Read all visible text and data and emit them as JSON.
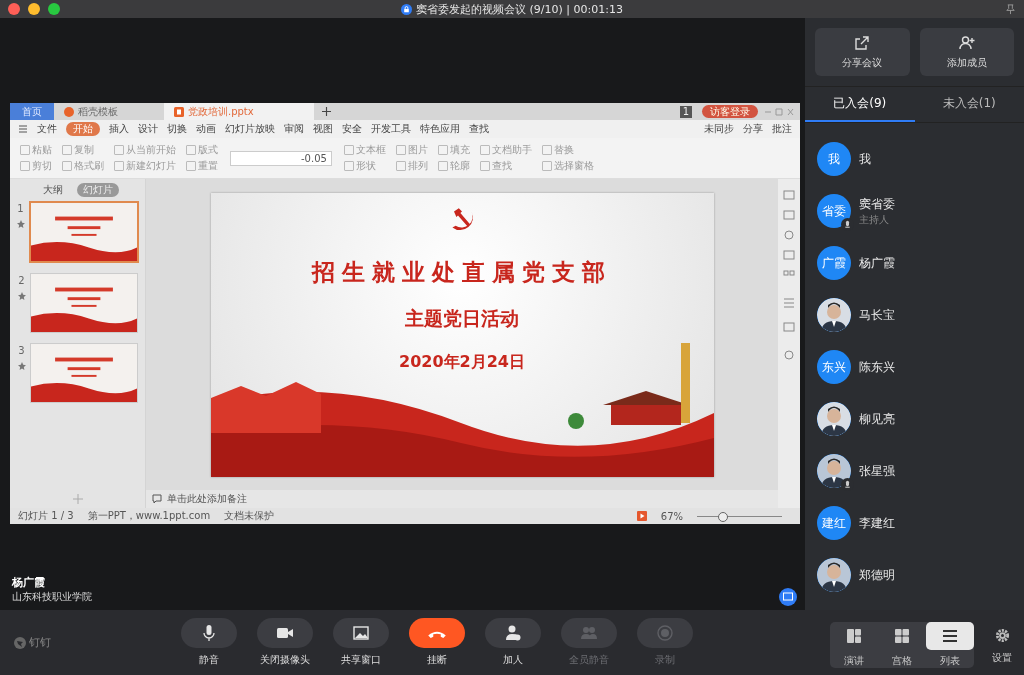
{
  "window": {
    "title": "窦省委发起的视频会议 (9/10) | 00:01:13"
  },
  "shared_screen": {
    "tabs": [
      {
        "label": "首页",
        "kind": "home",
        "selected": false
      },
      {
        "label": "稻壳模板",
        "kind": "template",
        "selected": false
      },
      {
        "label": "党政培训.pptx",
        "kind": "document",
        "selected": true
      }
    ],
    "page_count": "1",
    "login_button": "访客登录",
    "menu": [
      {
        "label": "文件",
        "selected": false
      },
      {
        "label": "开始",
        "selected": true
      },
      {
        "label": "插入",
        "selected": false
      },
      {
        "label": "设计",
        "selected": false
      },
      {
        "label": "切换",
        "selected": false
      },
      {
        "label": "动画",
        "selected": false
      },
      {
        "label": "幻灯片放映",
        "selected": false
      },
      {
        "label": "审阅",
        "selected": false
      },
      {
        "label": "视图",
        "selected": false
      },
      {
        "label": "安全",
        "selected": false
      },
      {
        "label": "开发工具",
        "selected": false
      },
      {
        "label": "特色应用",
        "selected": false
      },
      {
        "label": "查找",
        "selected": false
      }
    ],
    "menu_right": [
      "未同步",
      "分享",
      "批注"
    ],
    "ribbon_left": [
      "粘贴",
      "剪切",
      "复制",
      "格式刷",
      "从当前开始",
      "新建幻灯片",
      "版式",
      "重置"
    ],
    "font_size": "-0.05",
    "ribbon_right": [
      "文本框",
      "形状",
      "图片",
      "排列",
      "填充",
      "轮廓",
      "文档助手",
      "查找",
      "替换",
      "选择窗格"
    ],
    "panel_tabs": [
      {
        "label": "大纲",
        "selected": false
      },
      {
        "label": "幻灯片",
        "selected": true
      }
    ],
    "thumbnails": [
      {
        "number": "1",
        "selected": true
      },
      {
        "number": "2",
        "selected": false
      },
      {
        "number": "3",
        "selected": false
      }
    ],
    "slide": {
      "title": "招生就业处直属党支部",
      "subtitle": "主题党日活动",
      "date": "2020年2月24日"
    },
    "notes_placeholder": "单击此处添加备注",
    "status": {
      "slide_count": "幻灯片 1 / 3",
      "template": "第一PPT，www.1ppt.com",
      "protection": "文档未保护",
      "zoom": "67%",
      "zoom_slider": {
        "level": 0.3
      }
    }
  },
  "speaker": {
    "name": "杨广霞",
    "organization": "山东科技职业学院"
  },
  "brand": "钉钉",
  "controls": [
    {
      "label": "静音",
      "kind": "mic",
      "disabled": false
    },
    {
      "label": "关闭摄像头",
      "kind": "camera",
      "disabled": false
    },
    {
      "label": "共享窗口",
      "kind": "share",
      "disabled": false
    },
    {
      "label": "挂断",
      "kind": "hangup",
      "disabled": false
    },
    {
      "label": "加人",
      "kind": "add",
      "disabled": false
    },
    {
      "label": "全员静音",
      "kind": "muteall",
      "disabled": true
    },
    {
      "label": "录制",
      "kind": "record",
      "disabled": true
    }
  ],
  "views": [
    {
      "label": "演讲",
      "kind": "speaker",
      "selected": false
    },
    {
      "label": "宫格",
      "kind": "grid",
      "selected": false
    },
    {
      "label": "列表",
      "kind": "list",
      "selected": true
    }
  ],
  "settings": "设置",
  "panel": {
    "actions": [
      {
        "label": "分享会议",
        "kind": "share"
      },
      {
        "label": "添加成员",
        "kind": "add"
      }
    ],
    "tabs": [
      {
        "label": "已入会(9)",
        "selected": true
      },
      {
        "label": "未入会(1)",
        "selected": false
      }
    ],
    "participants": [
      {
        "name": "我",
        "kind": "initials",
        "avatar_text": "我",
        "mic_badge": false
      },
      {
        "name": "窦省委",
        "role": "主持人",
        "kind": "initials",
        "avatar_text": "省委",
        "mic_badge": true
      },
      {
        "name": "杨广霞",
        "kind": "initials",
        "avatar_text": "广霞",
        "mic_badge": false
      },
      {
        "name": "马长宝",
        "mic_badge": false
      },
      {
        "name": "陈东兴",
        "kind": "initials",
        "avatar_text": "东兴",
        "mic_badge": false
      },
      {
        "name": "柳见亮",
        "mic_badge": false
      },
      {
        "name": "张星强",
        "mic_badge": true
      },
      {
        "name": "李建红",
        "kind": "initials",
        "avatar_text": "建红",
        "mic_badge": false
      },
      {
        "name": "郑德明",
        "mic_badge": false
      }
    ]
  }
}
